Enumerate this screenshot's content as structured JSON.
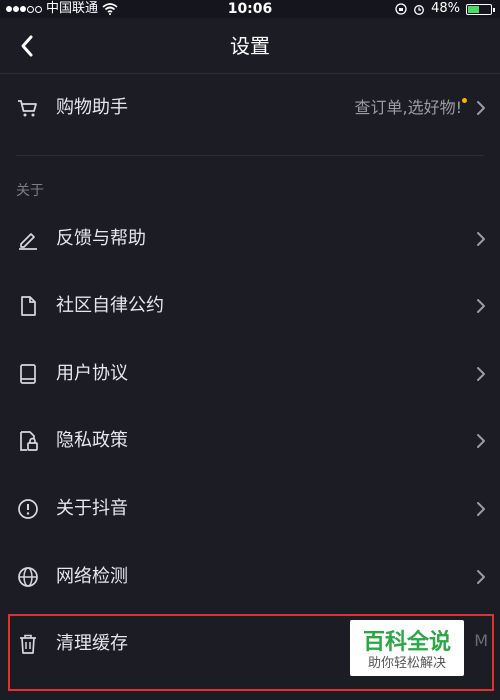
{
  "status_bar": {
    "carrier": "中国联通",
    "time": "10:06",
    "battery_percent": "48%",
    "battery_level": 0.48
  },
  "header": {
    "title": "设置"
  },
  "shopping": {
    "label": "购物助手",
    "value": "查订单,选好物!",
    "notification_color": "#f5b400"
  },
  "about_section": {
    "heading": "关于",
    "items": [
      {
        "label": "反馈与帮助",
        "icon": "edit-icon"
      },
      {
        "label": "社区自律公约",
        "icon": "document-icon"
      },
      {
        "label": "用户协议",
        "icon": "book-icon"
      },
      {
        "label": "隐私政策",
        "icon": "lock-icon"
      },
      {
        "label": "关于抖音",
        "icon": "info-icon"
      },
      {
        "label": "网络检测",
        "icon": "globe-icon"
      }
    ]
  },
  "clear_cache": {
    "label": "清理缓存",
    "value_tail": "M",
    "icon": "trash-icon"
  },
  "watermark": {
    "title": "百科全说",
    "subtitle": "助你轻松解决"
  },
  "colors": {
    "background": "#1b1c24",
    "highlight_border": "#e0322e",
    "watermark_green": "#2aa845"
  }
}
